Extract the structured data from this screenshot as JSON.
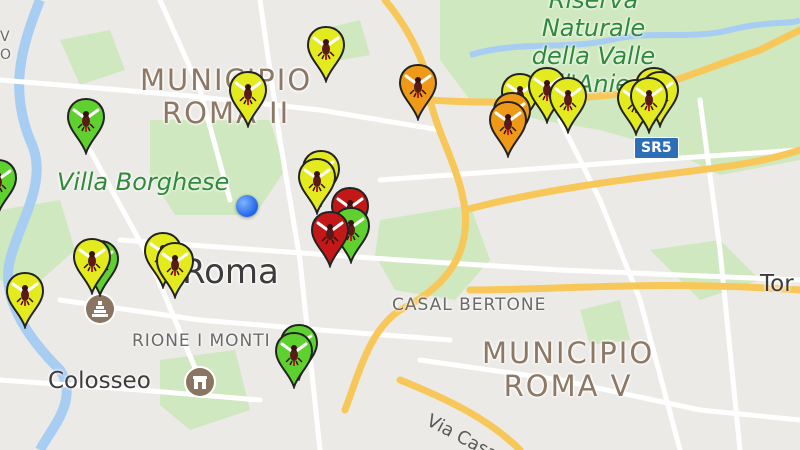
{
  "map": {
    "labels": {
      "municipio_ii": [
        "MUNICIPIO",
        "ROMA II"
      ],
      "municipio_v": [
        "MUNICIPIO",
        "ROMA V"
      ],
      "reserve": [
        "Riserva",
        "Naturale",
        "della Valle",
        "dell'Aniene"
      ],
      "villa_borghese": "Villa Borghese",
      "roma": "Roma",
      "casal_bertone": "CASAL BERTONE",
      "rione_monti": "RIONE I MONTI",
      "colosseo": "Colosseo",
      "via_casal": "Via Casa",
      "tor": "Tor",
      "edge_v": "V",
      "edge_o": "O",
      "road_shield": "SR5"
    },
    "colors": {
      "green": "#5ed12f",
      "yellow": "#e3eb1f",
      "orange": "#ef9a17",
      "red": "#c41818",
      "park": "#cfe8bf",
      "water": "#a7cdf2",
      "major_road": "#f7c859",
      "location_dot": "#1f63e8"
    },
    "markers": [
      {
        "name": "marker-yellow-1",
        "color": "yellow",
        "icon": "mosquito-icon"
      },
      {
        "name": "marker-yellow-2",
        "color": "yellow",
        "icon": "mosquito-icon"
      },
      {
        "name": "marker-orange-1",
        "color": "orange",
        "icon": "mosquito-icon"
      },
      {
        "name": "marker-green-1",
        "color": "green",
        "icon": "mosquito-icon"
      },
      {
        "name": "marker-green-2",
        "color": "green",
        "icon": "mosquito-icon"
      },
      {
        "name": "marker-yellow-3",
        "color": "yellow",
        "icon": "mosquito-icon"
      },
      {
        "name": "marker-yellow-4",
        "color": "yellow",
        "icon": "mosquito-icon"
      },
      {
        "name": "marker-red-1",
        "color": "red",
        "icon": "mosquito-icon"
      },
      {
        "name": "marker-green-3",
        "color": "green",
        "icon": "mosquito-icon"
      },
      {
        "name": "marker-red-2",
        "color": "red",
        "icon": "mosquito-icon"
      },
      {
        "name": "marker-yellow-5",
        "color": "yellow",
        "icon": "mosquito-icon"
      },
      {
        "name": "marker-green-4",
        "color": "green",
        "icon": "mosquito-icon"
      },
      {
        "name": "marker-yellow-6",
        "color": "yellow",
        "icon": "mosquito-icon"
      },
      {
        "name": "marker-yellow-7",
        "color": "yellow",
        "icon": "mosquito-icon"
      },
      {
        "name": "marker-yellow-8",
        "color": "yellow",
        "icon": "mosquito-icon"
      },
      {
        "name": "marker-green-5",
        "color": "green",
        "icon": "mosquito-icon"
      },
      {
        "name": "marker-green-6",
        "color": "green",
        "icon": "mosquito-icon"
      },
      {
        "name": "marker-yellow-9",
        "color": "yellow",
        "icon": "mosquito-icon"
      },
      {
        "name": "marker-yellow-10",
        "color": "yellow",
        "icon": "mosquito-icon"
      },
      {
        "name": "marker-orange-2",
        "color": "orange",
        "icon": "mosquito-icon"
      },
      {
        "name": "marker-orange-3",
        "color": "orange",
        "icon": "mosquito-icon"
      },
      {
        "name": "marker-yellow-11",
        "color": "yellow",
        "icon": "mosquito-icon"
      },
      {
        "name": "marker-yellow-12",
        "color": "yellow",
        "icon": "mosquito-icon"
      },
      {
        "name": "marker-yellow-13",
        "color": "yellow",
        "icon": "mosquito-icon"
      },
      {
        "name": "marker-yellow-14",
        "color": "yellow",
        "icon": "mosquito-icon"
      },
      {
        "name": "marker-yellow-15",
        "color": "yellow",
        "icon": "mosquito-icon"
      }
    ]
  }
}
